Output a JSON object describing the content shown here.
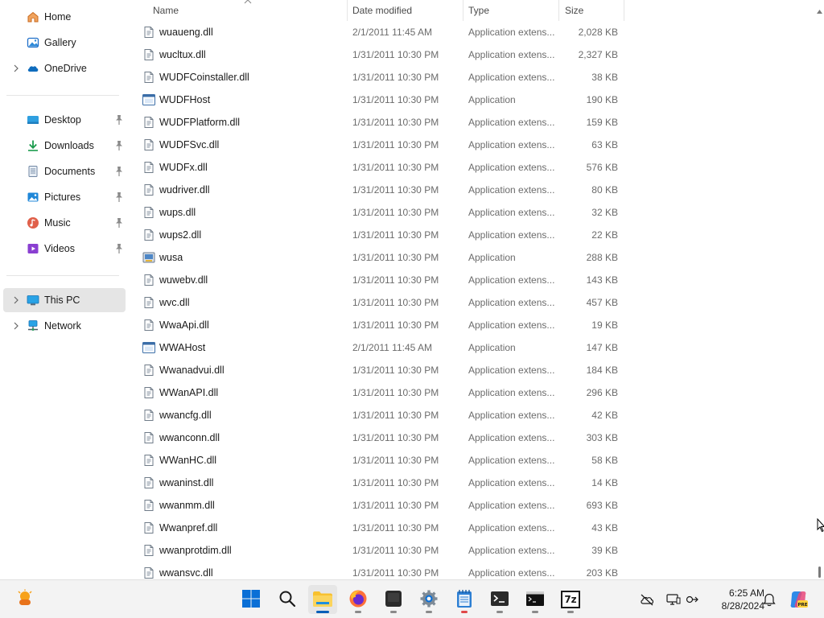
{
  "sidebar": {
    "top_items": [
      {
        "label": "Home",
        "icon": "home-icon",
        "has_chevron": false
      },
      {
        "label": "Gallery",
        "icon": "gallery-icon",
        "has_chevron": false
      },
      {
        "label": "OneDrive",
        "icon": "onedrive-icon",
        "has_chevron": true
      }
    ],
    "pinned_items": [
      {
        "label": "Desktop",
        "icon": "desktop-icon"
      },
      {
        "label": "Downloads",
        "icon": "downloads-icon"
      },
      {
        "label": "Documents",
        "icon": "documents-icon"
      },
      {
        "label": "Pictures",
        "icon": "pictures-icon"
      },
      {
        "label": "Music",
        "icon": "music-icon"
      },
      {
        "label": "Videos",
        "icon": "videos-icon"
      }
    ],
    "bottom_items": [
      {
        "label": "This PC",
        "icon": "this-pc-icon",
        "selected": true
      },
      {
        "label": "Network",
        "icon": "network-icon",
        "selected": false
      }
    ]
  },
  "columns": {
    "name": "Name",
    "date": "Date modified",
    "type": "Type",
    "size": "Size"
  },
  "files": [
    {
      "name": "wuaueng.dll",
      "date": "2/1/2011 11:45 AM",
      "type": "Application extens...",
      "size": "2,028 KB",
      "icon": "dll-file-icon"
    },
    {
      "name": "wucltux.dll",
      "date": "1/31/2011 10:30 PM",
      "type": "Application extens...",
      "size": "2,327 KB",
      "icon": "dll-file-icon"
    },
    {
      "name": "WUDFCoinstaller.dll",
      "date": "1/31/2011 10:30 PM",
      "type": "Application extens...",
      "size": "38 KB",
      "icon": "dll-file-icon"
    },
    {
      "name": "WUDFHost",
      "date": "1/31/2011 10:30 PM",
      "type": "Application",
      "size": "190 KB",
      "icon": "application-icon"
    },
    {
      "name": "WUDFPlatform.dll",
      "date": "1/31/2011 10:30 PM",
      "type": "Application extens...",
      "size": "159 KB",
      "icon": "dll-file-icon"
    },
    {
      "name": "WUDFSvc.dll",
      "date": "1/31/2011 10:30 PM",
      "type": "Application extens...",
      "size": "63 KB",
      "icon": "dll-file-icon"
    },
    {
      "name": "WUDFx.dll",
      "date": "1/31/2011 10:30 PM",
      "type": "Application extens...",
      "size": "576 KB",
      "icon": "dll-file-icon"
    },
    {
      "name": "wudriver.dll",
      "date": "1/31/2011 10:30 PM",
      "type": "Application extens...",
      "size": "80 KB",
      "icon": "dll-file-icon"
    },
    {
      "name": "wups.dll",
      "date": "1/31/2011 10:30 PM",
      "type": "Application extens...",
      "size": "32 KB",
      "icon": "dll-file-icon"
    },
    {
      "name": "wups2.dll",
      "date": "1/31/2011 10:30 PM",
      "type": "Application extens...",
      "size": "22 KB",
      "icon": "dll-file-icon"
    },
    {
      "name": "wusa",
      "date": "1/31/2011 10:30 PM",
      "type": "Application",
      "size": "288 KB",
      "icon": "installer-icon"
    },
    {
      "name": "wuwebv.dll",
      "date": "1/31/2011 10:30 PM",
      "type": "Application extens...",
      "size": "143 KB",
      "icon": "dll-file-icon"
    },
    {
      "name": "wvc.dll",
      "date": "1/31/2011 10:30 PM",
      "type": "Application extens...",
      "size": "457 KB",
      "icon": "dll-file-icon"
    },
    {
      "name": "WwaApi.dll",
      "date": "1/31/2011 10:30 PM",
      "type": "Application extens...",
      "size": "19 KB",
      "icon": "dll-file-icon"
    },
    {
      "name": "WWAHost",
      "date": "2/1/2011 11:45 AM",
      "type": "Application",
      "size": "147 KB",
      "icon": "application-icon"
    },
    {
      "name": "Wwanadvui.dll",
      "date": "1/31/2011 10:30 PM",
      "type": "Application extens...",
      "size": "184 KB",
      "icon": "dll-file-icon"
    },
    {
      "name": "WWanAPI.dll",
      "date": "1/31/2011 10:30 PM",
      "type": "Application extens...",
      "size": "296 KB",
      "icon": "dll-file-icon"
    },
    {
      "name": "wwancfg.dll",
      "date": "1/31/2011 10:30 PM",
      "type": "Application extens...",
      "size": "42 KB",
      "icon": "dll-file-icon"
    },
    {
      "name": "wwanconn.dll",
      "date": "1/31/2011 10:30 PM",
      "type": "Application extens...",
      "size": "303 KB",
      "icon": "dll-file-icon"
    },
    {
      "name": "WWanHC.dll",
      "date": "1/31/2011 10:30 PM",
      "type": "Application extens...",
      "size": "58 KB",
      "icon": "dll-file-icon"
    },
    {
      "name": "wwaninst.dll",
      "date": "1/31/2011 10:30 PM",
      "type": "Application extens...",
      "size": "14 KB",
      "icon": "dll-file-icon"
    },
    {
      "name": "wwanmm.dll",
      "date": "1/31/2011 10:30 PM",
      "type": "Application extens...",
      "size": "693 KB",
      "icon": "dll-file-icon"
    },
    {
      "name": "Wwanpref.dll",
      "date": "1/31/2011 10:30 PM",
      "type": "Application extens...",
      "size": "43 KB",
      "icon": "dll-file-icon"
    },
    {
      "name": "wwanprotdim.dll",
      "date": "1/31/2011 10:30 PM",
      "type": "Application extens...",
      "size": "39 KB",
      "icon": "dll-file-icon"
    },
    {
      "name": "wwansvc.dll",
      "date": "1/31/2011 10:30 PM",
      "type": "Application extens...",
      "size": "203 KB",
      "icon": "dll-file-icon"
    }
  ],
  "taskbar": {
    "apps": [
      {
        "name": "start-button",
        "icon": "windows-logo-icon"
      },
      {
        "name": "search-button",
        "icon": "search-icon"
      },
      {
        "name": "file-explorer-button",
        "icon": "folder-icon",
        "active": true
      },
      {
        "name": "firefox-button",
        "icon": "firefox-icon",
        "running": true
      },
      {
        "name": "app-dark-button",
        "icon": "app-icon",
        "running": true
      },
      {
        "name": "settings-button",
        "icon": "gear-icon",
        "running": true
      },
      {
        "name": "notepad-button",
        "icon": "notepad-icon",
        "running": true
      },
      {
        "name": "terminal-button",
        "icon": "terminal-icon",
        "running": true
      },
      {
        "name": "cmd-button",
        "icon": "cmd-icon",
        "running": true
      },
      {
        "name": "7zip-button",
        "icon": "7zip-icon",
        "label": "7z",
        "running": true
      }
    ],
    "clock_time": "6:25 AM",
    "clock_date": "8/28/2024",
    "colors": {
      "accent": "#005fb8",
      "folder": "#f8c12f",
      "copilot_badge": "PRE"
    }
  }
}
